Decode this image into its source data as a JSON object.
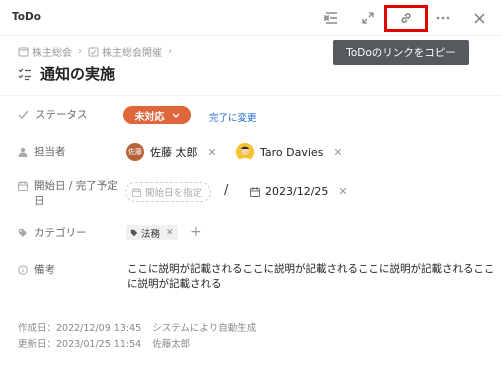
{
  "app": {
    "title": "ToDo"
  },
  "toolbar": {
    "tooltip": "ToDoのリンクをコピー"
  },
  "breadcrumb": {
    "items": [
      {
        "label": "株主総会"
      },
      {
        "label": "株主総会開催"
      }
    ]
  },
  "todo": {
    "title": "通知の実施"
  },
  "fields": {
    "status": {
      "label": "ステータス",
      "value": "未対応",
      "action": "完了に変更",
      "color": "#e0673c"
    },
    "assignee": {
      "label": "担当者",
      "people": [
        {
          "name": "佐藤 太郎",
          "avatar_text": "佐藤",
          "avatar_color": "#b5643a"
        },
        {
          "name": "Taro Davies",
          "avatar_text": "",
          "avatar_color": "#f4c430"
        }
      ]
    },
    "dates": {
      "label": "開始日 / 完了予定日",
      "start_placeholder": "開始日を指定",
      "separator": "/",
      "end": "2023/12/25"
    },
    "category": {
      "label": "カテゴリー",
      "tags": [
        {
          "label": "法務"
        }
      ]
    },
    "note": {
      "label": "備考",
      "text": "ここに説明が記載されるここに説明が記載されるここに説明が記載されるここに説明が記載される"
    }
  },
  "meta": {
    "created_label": "作成日：2022/12/09 13:45",
    "created_by": "システムにより自動生成",
    "updated_label": "更新日：2023/01/25 11:54",
    "updated_by": "佐藤太郎"
  },
  "colors": {
    "link": "#2468d0",
    "highlight": "#e60000",
    "tooltip_bg": "#555a5e"
  },
  "icons": {
    "toolbar": [
      "indent-icon",
      "expand-icon",
      "link-icon",
      "more-icon",
      "close-icon"
    ]
  }
}
